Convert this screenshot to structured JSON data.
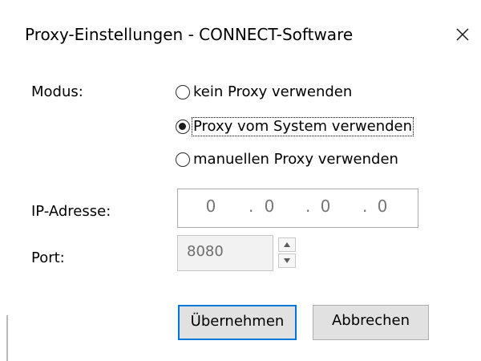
{
  "window": {
    "title": "Proxy-Einstellungen - CONNECT-Software",
    "close_icon": "close-icon"
  },
  "mode": {
    "label": "Modus:",
    "options": [
      {
        "label": "kein Proxy verwenden",
        "selected": false
      },
      {
        "label": "Proxy vom System verwenden",
        "selected": true
      },
      {
        "label": "manuellen Proxy verwenden",
        "selected": false
      }
    ]
  },
  "ip_address": {
    "label": "IP-Adresse:",
    "octets": [
      "0",
      "0",
      "0",
      "0"
    ],
    "separator": "."
  },
  "port": {
    "label": "Port:",
    "value": "8080",
    "up_icon": "spin-up-arrow-icon",
    "down_icon": "spin-down-arrow-icon"
  },
  "buttons": {
    "apply_label": "Übernehmen",
    "cancel_label": "Abbrechen"
  },
  "colors": {
    "focus_accent": "#0078d7",
    "button_face": "#e1e1e1",
    "disabled_text": "#767676"
  }
}
